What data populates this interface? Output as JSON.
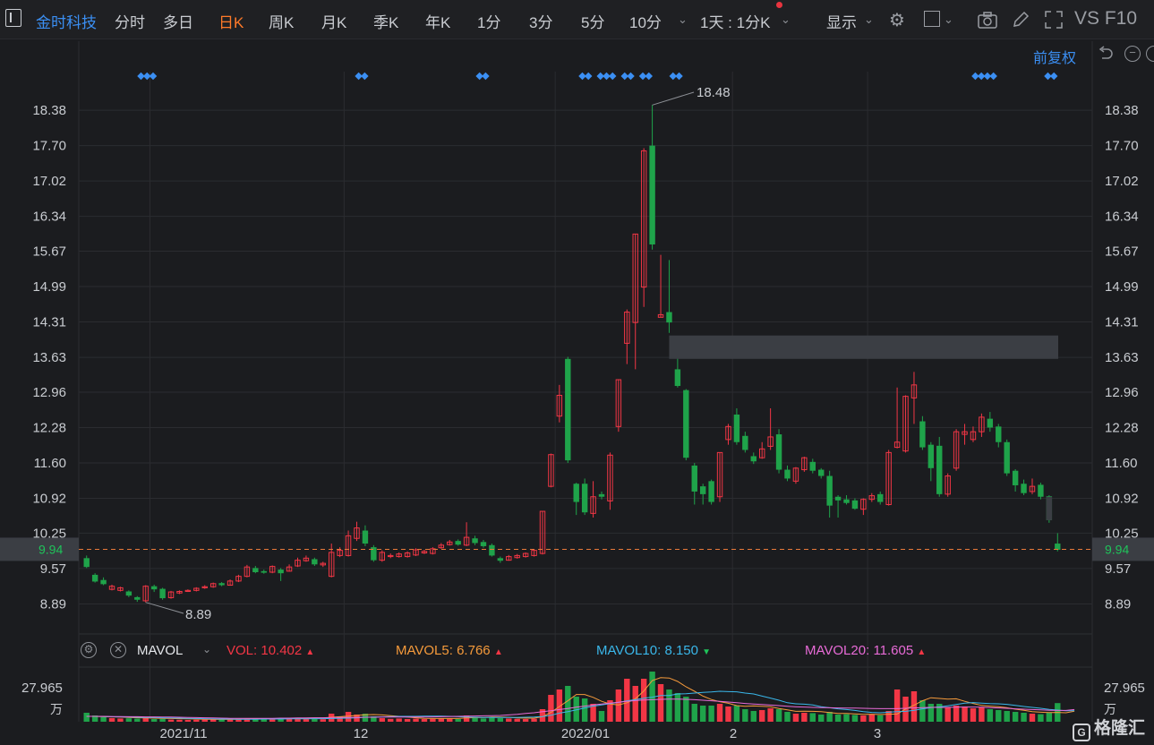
{
  "toolbar": {
    "stock_name": "金时科技",
    "periods": [
      "分时",
      "多日",
      "日K",
      "周K",
      "月K",
      "季K",
      "年K",
      "1分",
      "3分",
      "5分",
      "10分"
    ],
    "active_period": "日K",
    "multi_period": "1天 : 1分K",
    "display": "显示",
    "right_label": "VS F10"
  },
  "chart_header": {
    "fuquan": "前复权"
  },
  "colors": {
    "up": "#f23645",
    "down": "#1fa34a",
    "bg": "#1b1c1f",
    "grid": "#2b2c30",
    "current_price_line": "#e8793a"
  },
  "price_axis": {
    "ticks": [
      "18.38",
      "17.70",
      "17.02",
      "16.34",
      "15.67",
      "14.99",
      "14.31",
      "13.63",
      "12.96",
      "12.28",
      "11.60",
      "10.92",
      "10.25",
      "9.57",
      "8.89"
    ],
    "current": "9.94"
  },
  "annotations": {
    "high": "18.48",
    "low": "8.89"
  },
  "volume": {
    "indicator": "MAVOL",
    "vol_label": "VOL:",
    "vol_value": "10.402",
    "ma5_label": "MAVOL5:",
    "ma5_value": "6.766",
    "ma10_label": "MAVOL10:",
    "ma10_value": "8.150",
    "ma20_label": "MAVOL20:",
    "ma20_value": "11.605",
    "axis_top": "27.965",
    "axis_unit": "万"
  },
  "x_axis": {
    "labels": [
      "2021/11",
      "12",
      "2022/01",
      "2",
      "3"
    ]
  },
  "watermark": "格隆汇",
  "chart_data": {
    "type": "candlestick",
    "ylim": [
      8.45,
      18.95
    ],
    "x_labels": [
      "2021/11",
      "12",
      "2022/01",
      "2",
      "3"
    ],
    "candles": [
      [
        9.77,
        9.6,
        9.82,
        9.58,
        5.0
      ],
      [
        9.45,
        9.32,
        9.48,
        9.3,
        3.5
      ],
      [
        9.35,
        9.27,
        9.4,
        9.25,
        2.5
      ],
      [
        9.17,
        9.23,
        9.26,
        9.15,
        2.0
      ],
      [
        9.15,
        9.2,
        9.22,
        9.13,
        1.8
      ],
      [
        9.13,
        9.05,
        9.15,
        9.02,
        1.9
      ],
      [
        9.02,
        8.97,
        9.04,
        8.93,
        1.7
      ],
      [
        8.95,
        9.23,
        9.25,
        8.92,
        2.1
      ],
      [
        9.23,
        9.17,
        9.26,
        9.12,
        1.5
      ],
      [
        9.18,
        9.0,
        9.2,
        8.97,
        1.6
      ],
      [
        9.01,
        9.12,
        9.14,
        8.99,
        1.2
      ],
      [
        9.1,
        9.13,
        9.15,
        9.08,
        1.1
      ],
      [
        9.13,
        9.15,
        9.17,
        9.12,
        1.0
      ],
      [
        9.15,
        9.19,
        9.21,
        9.13,
        1.1
      ],
      [
        9.2,
        9.22,
        9.25,
        9.18,
        1.2
      ],
      [
        9.22,
        9.28,
        9.3,
        9.2,
        1.3
      ],
      [
        9.29,
        9.25,
        9.31,
        9.23,
        1.2
      ],
      [
        9.25,
        9.33,
        9.36,
        9.24,
        1.4
      ],
      [
        9.33,
        9.42,
        9.45,
        9.31,
        1.6
      ],
      [
        9.42,
        9.6,
        9.64,
        9.4,
        1.8
      ],
      [
        9.58,
        9.5,
        9.62,
        9.48,
        1.5
      ],
      [
        9.52,
        9.49,
        9.55,
        9.47,
        1.3
      ],
      [
        9.5,
        9.61,
        9.63,
        9.48,
        1.6
      ],
      [
        9.55,
        9.48,
        9.58,
        9.33,
        1.4
      ],
      [
        9.52,
        9.6,
        9.65,
        9.51,
        1.5
      ],
      [
        9.62,
        9.73,
        9.78,
        9.6,
        1.7
      ],
      [
        9.72,
        9.77,
        9.82,
        9.7,
        1.8
      ],
      [
        9.75,
        9.65,
        9.78,
        9.62,
        1.5
      ],
      [
        9.64,
        9.67,
        9.7,
        9.6,
        1.4
      ],
      [
        9.42,
        9.88,
        10.05,
        9.4,
        4.5
      ],
      [
        9.82,
        9.92,
        9.98,
        9.79,
        3.0
      ],
      [
        9.82,
        10.2,
        10.3,
        9.8,
        5.5
      ],
      [
        10.15,
        10.35,
        10.47,
        10.1,
        4.0
      ],
      [
        10.3,
        10.05,
        10.4,
        10.0,
        4.5
      ],
      [
        9.98,
        9.73,
        10.02,
        9.7,
        3.0
      ],
      [
        9.73,
        9.88,
        9.92,
        9.7,
        2.0
      ],
      [
        9.8,
        9.82,
        9.86,
        9.77,
        1.6
      ],
      [
        9.8,
        9.85,
        9.88,
        9.78,
        1.8
      ],
      [
        9.8,
        9.87,
        9.9,
        9.78,
        1.5
      ],
      [
        9.83,
        9.93,
        9.96,
        9.81,
        1.7
      ],
      [
        9.87,
        9.9,
        9.93,
        9.85,
        1.5
      ],
      [
        9.86,
        9.95,
        9.98,
        9.84,
        1.6
      ],
      [
        9.97,
        10.02,
        10.06,
        9.95,
        1.8
      ],
      [
        10.03,
        10.08,
        10.12,
        10.01,
        1.7
      ],
      [
        10.1,
        10.03,
        10.13,
        10.01,
        1.5
      ],
      [
        10.02,
        10.17,
        10.46,
        10.0,
        3.5
      ],
      [
        10.15,
        10.06,
        10.2,
        10.02,
        2.2
      ],
      [
        10.08,
        10.0,
        10.12,
        9.97,
        1.8
      ],
      [
        10.02,
        9.82,
        10.05,
        9.8,
        2.5
      ],
      [
        9.77,
        9.72,
        9.8,
        9.68,
        2.0
      ],
      [
        9.73,
        9.8,
        9.83,
        9.72,
        1.8
      ],
      [
        9.78,
        9.82,
        9.85,
        9.76,
        1.6
      ],
      [
        9.8,
        9.86,
        9.88,
        9.78,
        1.5
      ],
      [
        9.82,
        9.92,
        9.94,
        9.8,
        1.7
      ],
      [
        9.86,
        10.67,
        10.67,
        9.84,
        7.0
      ],
      [
        11.15,
        11.76,
        11.78,
        11.13,
        15.0
      ],
      [
        12.5,
        12.9,
        13.1,
        12.38,
        18.0
      ],
      [
        13.6,
        11.65,
        13.64,
        11.6,
        20.0
      ],
      [
        11.2,
        10.85,
        11.22,
        10.6,
        14.0
      ],
      [
        11.2,
        10.65,
        11.3,
        10.6,
        13.0
      ],
      [
        10.63,
        10.95,
        11.25,
        10.55,
        10.0
      ],
      [
        11.0,
        10.95,
        11.05,
        10.9,
        6.0
      ],
      [
        10.87,
        11.75,
        11.8,
        10.7,
        12.0
      ],
      [
        12.3,
        13.2,
        13.21,
        12.2,
        18.0
      ],
      [
        13.9,
        14.5,
        14.55,
        13.5,
        24.0
      ],
      [
        14.3,
        16.0,
        16.0,
        13.4,
        20.0
      ],
      [
        14.98,
        17.6,
        17.65,
        14.6,
        24.0
      ],
      [
        17.7,
        15.8,
        18.48,
        15.7,
        28.0
      ],
      [
        14.4,
        14.45,
        15.6,
        14.4,
        21.0
      ],
      [
        14.5,
        14.3,
        15.5,
        14.1,
        18.0
      ],
      [
        13.4,
        13.08,
        13.62,
        13.05,
        16.0
      ],
      [
        13.0,
        11.7,
        13.02,
        11.65,
        14.0
      ],
      [
        11.55,
        11.05,
        11.6,
        10.8,
        10.0
      ],
      [
        11.15,
        11.0,
        11.2,
        10.8,
        9.0
      ],
      [
        11.25,
        10.85,
        11.28,
        10.8,
        9.0
      ],
      [
        10.95,
        11.8,
        11.8,
        10.85,
        10.0
      ],
      [
        12.05,
        12.3,
        12.35,
        11.95,
        8.5
      ],
      [
        12.53,
        12.0,
        12.65,
        11.95,
        9.0
      ],
      [
        12.12,
        11.85,
        12.2,
        11.8,
        7.0
      ],
      [
        11.73,
        11.63,
        11.8,
        11.58,
        6.0
      ],
      [
        11.7,
        11.87,
        12.0,
        11.68,
        6.5
      ],
      [
        11.92,
        12.1,
        12.65,
        11.85,
        7.5
      ],
      [
        12.15,
        11.47,
        12.25,
        11.4,
        7.0
      ],
      [
        11.47,
        11.3,
        11.55,
        11.25,
        5.5
      ],
      [
        11.25,
        11.5,
        11.52,
        11.2,
        4.5
      ],
      [
        11.47,
        11.7,
        11.72,
        11.43,
        5.0
      ],
      [
        11.62,
        11.45,
        11.68,
        11.4,
        4.8
      ],
      [
        11.47,
        11.35,
        11.5,
        11.3,
        4.0
      ],
      [
        11.35,
        10.78,
        11.45,
        10.55,
        5.5
      ],
      [
        10.95,
        10.88,
        10.98,
        10.55,
        4.0
      ],
      [
        10.9,
        10.83,
        10.98,
        10.8,
        4.2
      ],
      [
        10.88,
        10.72,
        10.92,
        10.7,
        3.8
      ],
      [
        10.71,
        10.9,
        10.92,
        10.6,
        3.5
      ],
      [
        10.9,
        10.97,
        11.02,
        10.85,
        4.0
      ],
      [
        11.0,
        10.85,
        11.05,
        10.8,
        3.6
      ],
      [
        10.8,
        11.8,
        11.85,
        10.78,
        6.0
      ],
      [
        11.9,
        12.0,
        13.05,
        11.88,
        18.0
      ],
      [
        11.83,
        12.88,
        12.9,
        11.8,
        14.0
      ],
      [
        12.85,
        13.1,
        13.35,
        12.35,
        17.0
      ],
      [
        12.4,
        11.9,
        12.5,
        11.85,
        12.0
      ],
      [
        11.95,
        11.5,
        12.0,
        11.25,
        10.0
      ],
      [
        11.93,
        11.0,
        12.1,
        10.95,
        10.0
      ],
      [
        11.0,
        11.35,
        11.4,
        10.95,
        8.0
      ],
      [
        11.5,
        12.2,
        12.25,
        11.45,
        9.0
      ],
      [
        12.15,
        12.2,
        12.35,
        11.95,
        8.5
      ],
      [
        12.05,
        12.2,
        12.3,
        12.0,
        7.5
      ],
      [
        12.2,
        12.48,
        12.55,
        12.1,
        8.0
      ],
      [
        12.45,
        12.28,
        12.58,
        12.2,
        7.0
      ],
      [
        12.3,
        12.0,
        12.35,
        11.9,
        6.5
      ],
      [
        12.0,
        11.4,
        12.05,
        11.35,
        6.0
      ],
      [
        11.45,
        11.17,
        11.48,
        11.05,
        5.5
      ],
      [
        11.2,
        11.02,
        11.28,
        10.98,
        5.0
      ],
      [
        11.05,
        11.15,
        11.3,
        11.0,
        4.5
      ],
      [
        11.18,
        10.95,
        11.22,
        10.9,
        4.2
      ],
      [
        10.96,
        10.5,
        10.98,
        10.45,
        5.0
      ],
      [
        10.05,
        9.93,
        10.25,
        9.9,
        10.4
      ]
    ],
    "mavol5": [
      3.0,
      3.0,
      2.8,
      2.7,
      2.6,
      2.4,
      2.2,
      2.1,
      2.0,
      1.9,
      1.8,
      1.7,
      1.6,
      1.5,
      1.4,
      1.3,
      1.3,
      1.3,
      1.4,
      1.5,
      1.6,
      1.7,
      1.7,
      1.8,
      1.8,
      1.9,
      2.0,
      2.1,
      2.1,
      2.5,
      2.8,
      3.1,
      3.5,
      3.9,
      4.0,
      3.8,
      3.4,
      3.0,
      2.6,
      2.2,
      1.9,
      1.8,
      1.8,
      1.8,
      1.8,
      2.1,
      2.3,
      2.3,
      2.6,
      2.6,
      2.5,
      2.1,
      2.0,
      2.0,
      2.8,
      5.2,
      8.5,
      11.7,
      15.2,
      15.2,
      13.6,
      11.4,
      9.9,
      9.4,
      10.6,
      12.8,
      17.2,
      23.0,
      24.6,
      24.4,
      22.5,
      19.5,
      17.0,
      14.3,
      12.4,
      11.2,
      10.3,
      9.0,
      8.6,
      8.8,
      8.6,
      8.4,
      7.4,
      6.6,
      5.8,
      5.9,
      5.8,
      5.6,
      5.1,
      4.6,
      4.6,
      4.4,
      4.1,
      4.2,
      4.0,
      4.2,
      4.3,
      7.1,
      9.2,
      11.7,
      13.4,
      13.0,
      12.6,
      12.8,
      11.4,
      10.2,
      9.1,
      8.7,
      8.4,
      7.8,
      7.0,
      6.4,
      5.6,
      5.3,
      5.1,
      5.2,
      5.0,
      5.9
    ],
    "mavol10": [
      3.0,
      3.0,
      2.9,
      2.8,
      2.7,
      2.6,
      2.5,
      2.4,
      2.4,
      2.2,
      2.1,
      2.0,
      1.9,
      1.8,
      1.7,
      1.6,
      1.5,
      1.5,
      1.4,
      1.4,
      1.4,
      1.5,
      1.5,
      1.5,
      1.6,
      1.6,
      1.6,
      1.7,
      1.7,
      1.8,
      1.9,
      2.0,
      2.2,
      2.5,
      2.6,
      2.7,
      2.9,
      3.0,
      3.0,
      3.0,
      3.1,
      3.1,
      3.1,
      3.0,
      2.8,
      2.6,
      2.5,
      2.4,
      2.4,
      2.4,
      2.4,
      2.4,
      2.5,
      2.6,
      2.9,
      3.6,
      4.8,
      5.6,
      6.6,
      7.7,
      8.7,
      9.4,
      10.1,
      10.8,
      11.7,
      12.3,
      13.1,
      13.7,
      14.6,
      14.6,
      15.5,
      15.6,
      16.0,
      16.4,
      16.6,
      17.0,
      16.8,
      16.7,
      16.0,
      15.5,
      14.3,
      13.2,
      12.0,
      10.6,
      10.0,
      9.8,
      9.4,
      8.4,
      7.8,
      7.2,
      6.8,
      6.3,
      5.6,
      5.2,
      5.0,
      5.3,
      5.6,
      5.8,
      6.4,
      7.2,
      7.9,
      8.3,
      8.9,
      9.6,
      10.4,
      10.7,
      10.4,
      10.1,
      10.0,
      9.7,
      9.1,
      8.5,
      8.0,
      7.5,
      6.9,
      6.5,
      6.1,
      6.2
    ],
    "mavol20": [
      3.0,
      3.0,
      3.0,
      2.9,
      2.9,
      2.8,
      2.8,
      2.7,
      2.7,
      2.6,
      2.6,
      2.5,
      2.4,
      2.3,
      2.2,
      2.1,
      2.0,
      1.9,
      1.9,
      1.9,
      1.9,
      1.9,
      1.9,
      2.0,
      2.0,
      2.1,
      2.1,
      2.2,
      2.2,
      2.3,
      2.4,
      2.4,
      2.4,
      2.5,
      2.5,
      2.6,
      2.6,
      2.6,
      2.6,
      2.6,
      2.6,
      2.7,
      2.8,
      2.9,
      3.0,
      3.1,
      3.2,
      3.3,
      3.4,
      3.5,
      3.8,
      4.1,
      4.6,
      5.0,
      5.6,
      6.1,
      6.8,
      7.4,
      8.1,
      8.7,
      9.4,
      9.9,
      10.4,
      10.9,
      11.4,
      11.8,
      12.1,
      12.3,
      12.5,
      12.6,
      12.6,
      12.5,
      12.3,
      12.0,
      11.7,
      11.4,
      11.0,
      10.6,
      10.2,
      9.9,
      9.6,
      9.3,
      9.0,
      8.6,
      8.3,
      8.2,
      8.0,
      7.9,
      7.8,
      7.7,
      7.6,
      7.6,
      7.5,
      7.4,
      7.3,
      7.3,
      7.3,
      7.5,
      7.7,
      7.9,
      8.0,
      8.0,
      8.0,
      8.1,
      8.2,
      8.2,
      8.1,
      7.9,
      7.7,
      7.5,
      7.2,
      7.0,
      6.8,
      6.6,
      6.4,
      6.3,
      6.3,
      6.8
    ]
  }
}
